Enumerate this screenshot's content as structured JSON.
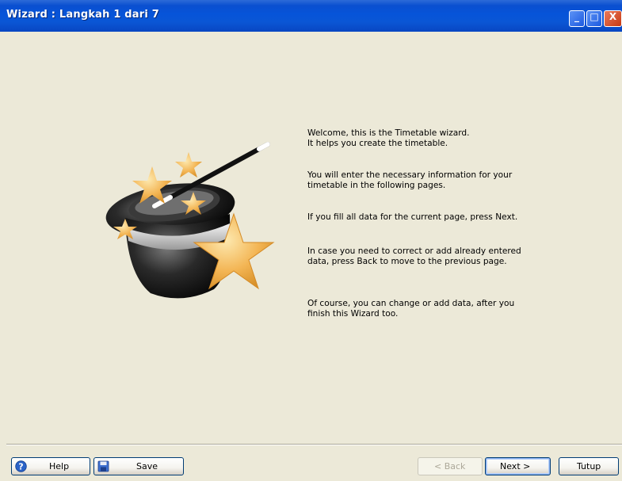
{
  "window": {
    "title": "Wizard : Langkah 1 dari 7",
    "controls": {
      "minimize": "_",
      "maximize": "□",
      "close": "X"
    }
  },
  "content": {
    "illustration": "magic-hat-wand-stars",
    "paragraphs": [
      [
        "Welcome, this is the Timetable wizard.",
        "It helps you create the timetable."
      ],
      [
        "You will enter the necessary information for your",
        "timetable in the following pages."
      ],
      [
        "If you fill all data for the current page, press Next."
      ],
      [
        "In case you need to correct or add already entered",
        "data, press Back to move to the previous page."
      ],
      [
        "Of course, you can change or add data, after you",
        "finish this Wizard too."
      ]
    ]
  },
  "buttons": {
    "help": "Help",
    "save": "Save",
    "back": "< Back",
    "next": "Next >",
    "close": "Tutup"
  },
  "colors": {
    "titlebar": "#0a56d5",
    "client_bg": "#ece9d8",
    "button_border": "#003c74"
  }
}
